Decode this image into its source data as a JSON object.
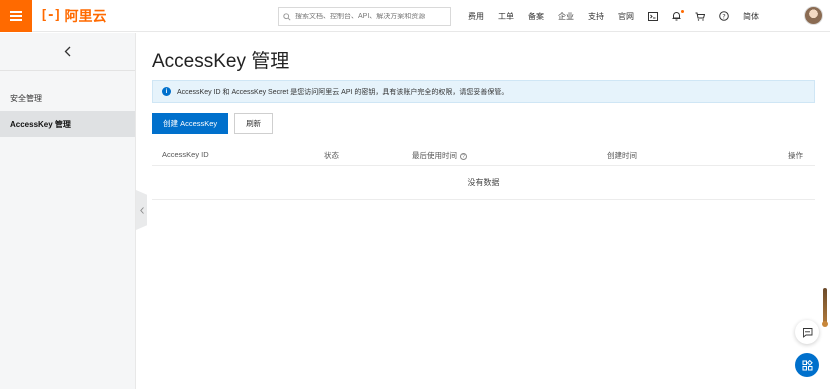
{
  "brand": {
    "logo_text": "阿里云",
    "accent": "#ff6a00",
    "primary": "#0070cc"
  },
  "search": {
    "placeholder": "搜索文档、控制台、API、解决方案和资源"
  },
  "topnav": {
    "links": [
      "费用",
      "工单",
      "备案",
      "企业",
      "支持",
      "官网"
    ],
    "icons": [
      "terminal-icon",
      "bell-icon",
      "cart-icon",
      "help-icon"
    ],
    "language": "简体"
  },
  "sidebar": {
    "items": [
      {
        "label": "安全管理",
        "active": false
      },
      {
        "label": "AccessKey 管理",
        "active": true
      }
    ]
  },
  "main": {
    "title": "AccessKey 管理",
    "notice": "AccessKey ID 和 AccessKey Secret 是您访问阿里云 API 的密钥，具有该账户完全的权限，请您妥善保管。",
    "create_button": "创建 AccessKey",
    "refresh_button": "刷新",
    "table": {
      "columns": [
        "AccessKey ID",
        "状态",
        "最后使用时间",
        "创建时间",
        "操作"
      ],
      "empty_text": "没有数据"
    }
  }
}
